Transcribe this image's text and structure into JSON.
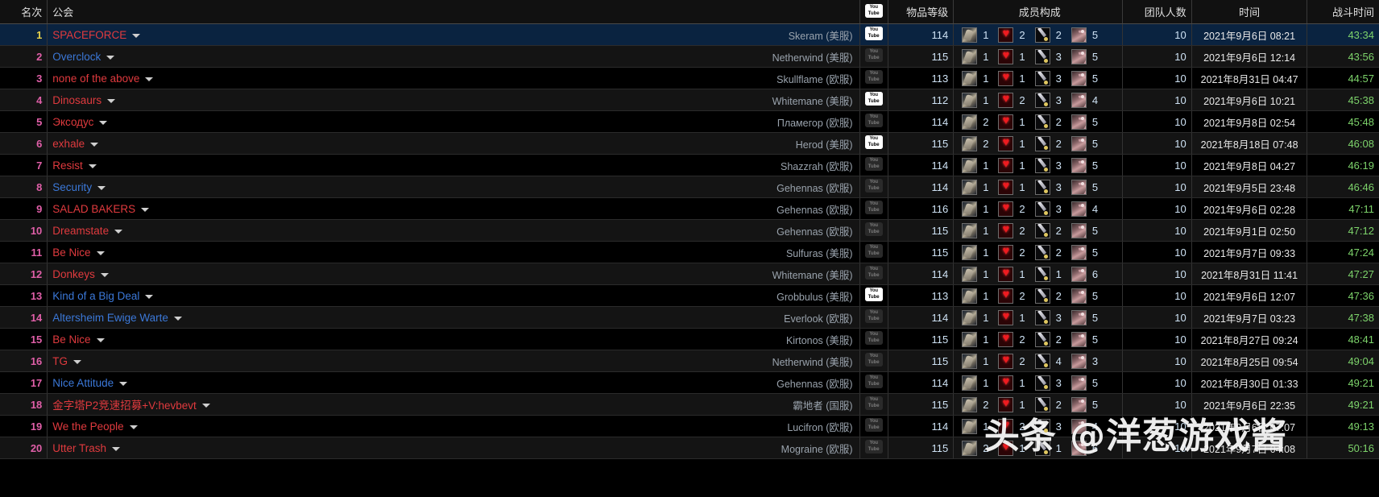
{
  "header": {
    "rank": "名次",
    "guild": "公会",
    "youtube_icon": "youtube-icon",
    "item_level": "物品等级",
    "composition": "成员构成",
    "raid_size": "团队人数",
    "time": "时间",
    "duration": "战斗时间"
  },
  "colors": {
    "horde": "#e03a3e",
    "alliance": "#3b78d8",
    "rank_top": "#e8d24a",
    "rank_other": "#e05fa8",
    "duration": "#7dd36b",
    "highlight_row": "#0a2340"
  },
  "watermark": "头条 @洋葱游戏酱",
  "rows": [
    {
      "rank": "1",
      "guild": "SPACEFORCE",
      "faction": "horde",
      "realm": "Skeram (美服)",
      "yt": "on",
      "ilvl": "114",
      "comp": [
        {
          "icon": "warrior",
          "n": "1"
        },
        {
          "icon": "heart",
          "n": "2"
        },
        {
          "icon": "rogue",
          "n": "2"
        },
        {
          "icon": "claw",
          "n": "5"
        }
      ],
      "raiders": "10",
      "time": "2021年9月6日 08:21",
      "dur": "43:34"
    },
    {
      "rank": "2",
      "guild": "Overclock",
      "faction": "alliance",
      "realm": "Netherwind (美服)",
      "yt": "off",
      "ilvl": "115",
      "comp": [
        {
          "icon": "warrior",
          "n": "1"
        },
        {
          "icon": "heart",
          "n": "1"
        },
        {
          "icon": "rogue",
          "n": "3"
        },
        {
          "icon": "claw",
          "n": "5"
        }
      ],
      "raiders": "10",
      "time": "2021年9月6日 12:14",
      "dur": "43:56"
    },
    {
      "rank": "3",
      "guild": "none of the above",
      "faction": "horde",
      "realm": "Skullflame (欧服)",
      "yt": "off",
      "ilvl": "113",
      "comp": [
        {
          "icon": "warrior",
          "n": "1"
        },
        {
          "icon": "heart",
          "n": "1"
        },
        {
          "icon": "rogue",
          "n": "3"
        },
        {
          "icon": "claw",
          "n": "5"
        }
      ],
      "raiders": "10",
      "time": "2021年8月31日 04:47",
      "dur": "44:57"
    },
    {
      "rank": "4",
      "guild": "Dinosaurs",
      "faction": "horde",
      "realm": "Whitemane (美服)",
      "yt": "on",
      "ilvl": "112",
      "comp": [
        {
          "icon": "warrior",
          "n": "1"
        },
        {
          "icon": "heart",
          "n": "2"
        },
        {
          "icon": "rogue",
          "n": "3"
        },
        {
          "icon": "claw",
          "n": "4"
        }
      ],
      "raiders": "10",
      "time": "2021年9月6日 10:21",
      "dur": "45:38"
    },
    {
      "rank": "5",
      "guild": "Эксодус",
      "faction": "horde",
      "realm": "Пламегор (欧服)",
      "yt": "off",
      "ilvl": "114",
      "comp": [
        {
          "icon": "warrior",
          "n": "2"
        },
        {
          "icon": "heart",
          "n": "1"
        },
        {
          "icon": "rogue",
          "n": "2"
        },
        {
          "icon": "claw",
          "n": "5"
        }
      ],
      "raiders": "10",
      "time": "2021年9月8日 02:54",
      "dur": "45:48"
    },
    {
      "rank": "6",
      "guild": "exhale",
      "faction": "horde",
      "realm": "Herod (美服)",
      "yt": "on",
      "ilvl": "115",
      "comp": [
        {
          "icon": "warrior",
          "n": "2"
        },
        {
          "icon": "heart",
          "n": "1"
        },
        {
          "icon": "rogue",
          "n": "2"
        },
        {
          "icon": "claw",
          "n": "5"
        }
      ],
      "raiders": "10",
      "time": "2021年8月18日 07:48",
      "dur": "46:08"
    },
    {
      "rank": "7",
      "guild": "Resist",
      "faction": "horde",
      "realm": "Shazzrah (欧服)",
      "yt": "off",
      "ilvl": "114",
      "comp": [
        {
          "icon": "warrior",
          "n": "1"
        },
        {
          "icon": "heart",
          "n": "1"
        },
        {
          "icon": "rogue",
          "n": "3"
        },
        {
          "icon": "claw",
          "n": "5"
        }
      ],
      "raiders": "10",
      "time": "2021年9月8日 04:27",
      "dur": "46:19"
    },
    {
      "rank": "8",
      "guild": "Security",
      "faction": "alliance",
      "realm": "Gehennas (欧服)",
      "yt": "off",
      "ilvl": "114",
      "comp": [
        {
          "icon": "warrior",
          "n": "1"
        },
        {
          "icon": "heart",
          "n": "1"
        },
        {
          "icon": "rogue",
          "n": "3"
        },
        {
          "icon": "claw",
          "n": "5"
        }
      ],
      "raiders": "10",
      "time": "2021年9月5日 23:48",
      "dur": "46:46"
    },
    {
      "rank": "9",
      "guild": "SALAD BAKERS",
      "faction": "horde",
      "realm": "Gehennas (欧服)",
      "yt": "off",
      "ilvl": "116",
      "comp": [
        {
          "icon": "warrior",
          "n": "1"
        },
        {
          "icon": "heart",
          "n": "2"
        },
        {
          "icon": "rogue",
          "n": "3"
        },
        {
          "icon": "claw",
          "n": "4"
        }
      ],
      "raiders": "10",
      "time": "2021年9月6日 02:28",
      "dur": "47:11"
    },
    {
      "rank": "10",
      "guild": "Dreamstate",
      "faction": "horde",
      "realm": "Gehennas (欧服)",
      "yt": "off",
      "ilvl": "115",
      "comp": [
        {
          "icon": "warrior",
          "n": "1"
        },
        {
          "icon": "heart",
          "n": "2"
        },
        {
          "icon": "rogue",
          "n": "2"
        },
        {
          "icon": "claw",
          "n": "5"
        }
      ],
      "raiders": "10",
      "time": "2021年9月1日 02:50",
      "dur": "47:12"
    },
    {
      "rank": "11",
      "guild": "Be Nice",
      "faction": "horde",
      "realm": "Sulfuras (美服)",
      "yt": "off",
      "ilvl": "115",
      "comp": [
        {
          "icon": "warrior",
          "n": "1"
        },
        {
          "icon": "heart",
          "n": "2"
        },
        {
          "icon": "rogue",
          "n": "2"
        },
        {
          "icon": "claw",
          "n": "5"
        }
      ],
      "raiders": "10",
      "time": "2021年9月7日 09:33",
      "dur": "47:24"
    },
    {
      "rank": "12",
      "guild": "Donkeys",
      "faction": "horde",
      "realm": "Whitemane (美服)",
      "yt": "off",
      "ilvl": "114",
      "comp": [
        {
          "icon": "warrior",
          "n": "1"
        },
        {
          "icon": "heart",
          "n": "1"
        },
        {
          "icon": "rogue",
          "n": "1"
        },
        {
          "icon": "claw",
          "n": "6"
        }
      ],
      "raiders": "10",
      "time": "2021年8月31日 11:41",
      "dur": "47:27"
    },
    {
      "rank": "13",
      "guild": "Kind of a Big Deal",
      "faction": "alliance",
      "realm": "Grobbulus (美服)",
      "yt": "on",
      "ilvl": "113",
      "comp": [
        {
          "icon": "warrior",
          "n": "1"
        },
        {
          "icon": "heart",
          "n": "2"
        },
        {
          "icon": "rogue",
          "n": "2"
        },
        {
          "icon": "claw",
          "n": "5"
        }
      ],
      "raiders": "10",
      "time": "2021年9月6日 12:07",
      "dur": "47:36"
    },
    {
      "rank": "14",
      "guild": "Altersheim Ewige Warte",
      "faction": "alliance",
      "realm": "Everlook (欧服)",
      "yt": "off",
      "ilvl": "114",
      "comp": [
        {
          "icon": "warrior",
          "n": "1"
        },
        {
          "icon": "heart",
          "n": "1"
        },
        {
          "icon": "rogue",
          "n": "3"
        },
        {
          "icon": "claw",
          "n": "5"
        }
      ],
      "raiders": "10",
      "time": "2021年9月7日 03:23",
      "dur": "47:38"
    },
    {
      "rank": "15",
      "guild": "Be Nice",
      "faction": "horde",
      "realm": "Kirtonos (美服)",
      "yt": "off",
      "ilvl": "115",
      "comp": [
        {
          "icon": "warrior",
          "n": "1"
        },
        {
          "icon": "heart",
          "n": "2"
        },
        {
          "icon": "rogue",
          "n": "2"
        },
        {
          "icon": "claw",
          "n": "5"
        }
      ],
      "raiders": "10",
      "time": "2021年8月27日 09:24",
      "dur": "48:41"
    },
    {
      "rank": "16",
      "guild": "TG",
      "faction": "horde",
      "realm": "Netherwind (美服)",
      "yt": "off",
      "ilvl": "115",
      "comp": [
        {
          "icon": "warrior",
          "n": "1"
        },
        {
          "icon": "heart",
          "n": "2"
        },
        {
          "icon": "rogue",
          "n": "4"
        },
        {
          "icon": "claw",
          "n": "3"
        }
      ],
      "raiders": "10",
      "time": "2021年8月25日 09:54",
      "dur": "49:04"
    },
    {
      "rank": "17",
      "guild": "Nice Attitude",
      "faction": "alliance",
      "realm": "Gehennas (欧服)",
      "yt": "off",
      "ilvl": "114",
      "comp": [
        {
          "icon": "warrior",
          "n": "1"
        },
        {
          "icon": "heart",
          "n": "1"
        },
        {
          "icon": "rogue",
          "n": "3"
        },
        {
          "icon": "claw",
          "n": "5"
        }
      ],
      "raiders": "10",
      "time": "2021年8月30日 01:33",
      "dur": "49:21"
    },
    {
      "rank": "18",
      "guild": "金字塔P2竞速招募+V:hevbevt",
      "faction": "horde",
      "realm": "霸地者 (国服)",
      "yt": "off",
      "ilvl": "115",
      "comp": [
        {
          "icon": "warrior",
          "n": "2"
        },
        {
          "icon": "heart",
          "n": "1"
        },
        {
          "icon": "rogue",
          "n": "2"
        },
        {
          "icon": "claw",
          "n": "5"
        }
      ],
      "raiders": "10",
      "time": "2021年9月6日 22:35",
      "dur": "49:21"
    },
    {
      "rank": "19",
      "guild": "We the People",
      "faction": "horde",
      "realm": "Lucifron (欧服)",
      "yt": "off",
      "ilvl": "114",
      "comp": [
        {
          "icon": "warrior",
          "n": "1"
        },
        {
          "icon": "heart",
          "n": "2"
        },
        {
          "icon": "rogue",
          "n": "3"
        },
        {
          "icon": "claw",
          "n": "4"
        }
      ],
      "raiders": "10",
      "time": "2021年9月6日 07:07",
      "dur": "49:13"
    },
    {
      "rank": "20",
      "guild": "Utter Trash",
      "faction": "horde",
      "realm": "Mograine (欧服)",
      "yt": "off",
      "ilvl": "115",
      "comp": [
        {
          "icon": "warrior",
          "n": "2"
        },
        {
          "icon": "heart",
          "n": "1"
        },
        {
          "icon": "rogue",
          "n": "1"
        },
        {
          "icon": "claw",
          "n": "6"
        }
      ],
      "raiders": "10",
      "time": "2021年9月7日 04:08",
      "dur": "50:16"
    }
  ]
}
